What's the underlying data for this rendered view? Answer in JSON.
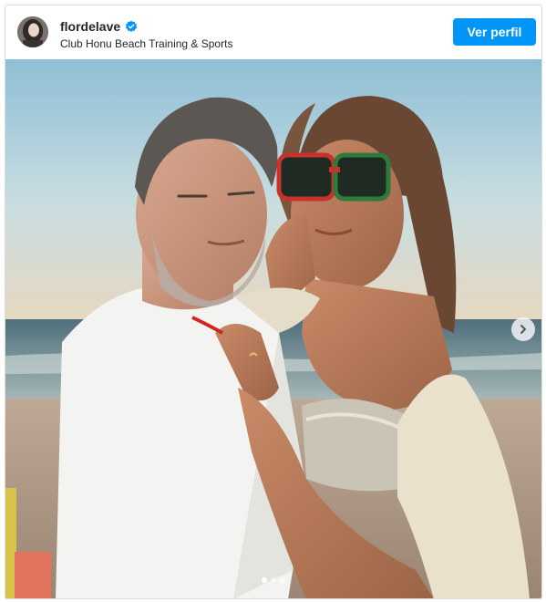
{
  "post": {
    "username": "flordelave",
    "location": "Club Honu Beach Training & Sports",
    "view_profile_label": "Ver perfil",
    "verified": true,
    "carousel": {
      "total_slides": 3,
      "current_slide": 1
    }
  },
  "icons": {
    "verified": "verified-badge-icon",
    "next": "chevron-right-icon"
  },
  "colors": {
    "accent": "#0095f6",
    "verified": "#0095f6",
    "text": "#262626",
    "border": "#dbdbdb"
  }
}
